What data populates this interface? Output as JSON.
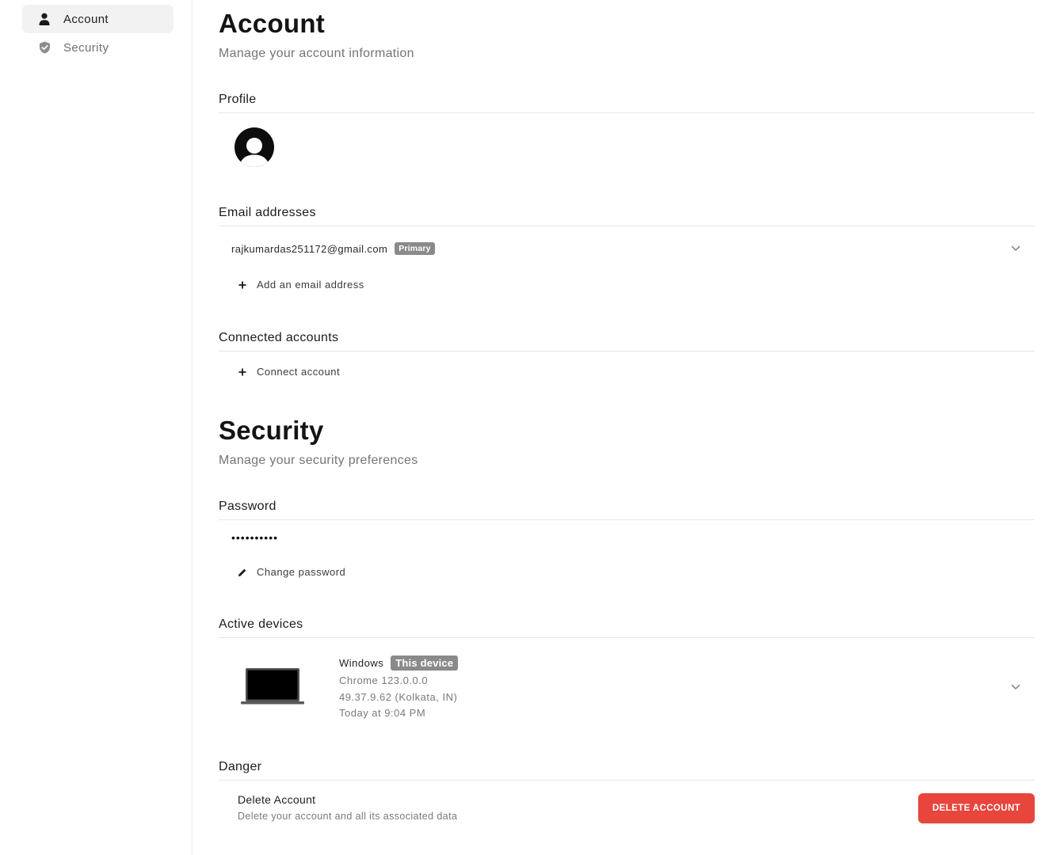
{
  "sidebar": {
    "items": [
      {
        "label": "Account",
        "icon": "person-icon",
        "active": true
      },
      {
        "label": "Security",
        "icon": "shield-icon",
        "active": false
      }
    ]
  },
  "account": {
    "title": "Account",
    "subtitle": "Manage your account information",
    "profile": {
      "title": "Profile"
    },
    "emails": {
      "title": "Email addresses",
      "address": "rajkumardas251172@gmail.com",
      "badge": "Primary",
      "add_label": "Add an email address"
    },
    "connected": {
      "title": "Connected accounts",
      "connect_label": "Connect account"
    }
  },
  "security": {
    "title": "Security",
    "subtitle": "Manage your security preferences",
    "password": {
      "title": "Password",
      "masked": "••••••••••",
      "change_label": "Change password"
    },
    "devices": {
      "title": "Active devices",
      "os": "Windows",
      "badge": "This device",
      "browser": "Chrome 123.0.0.0",
      "location": "49.37.9.62 (Kolkata, IN)",
      "last_active": "Today at 9:04 PM"
    },
    "danger": {
      "title": "Danger",
      "item_title": "Delete Account",
      "item_desc": "Delete your account and all its associated data",
      "button_label": "DELETE ACCOUNT",
      "button_color": "#e8453c"
    }
  }
}
